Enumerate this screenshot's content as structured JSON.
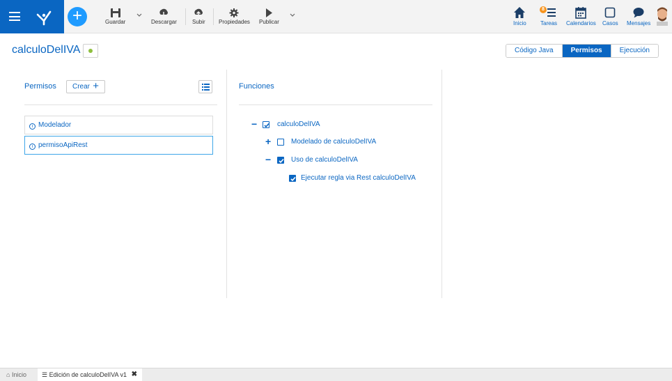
{
  "toolbar": {
    "save_label": "Guardar",
    "download_label": "Descargar",
    "upload_label": "Subir",
    "properties_label": "Propiedades",
    "publish_label": "Publicar"
  },
  "nav": {
    "home_label": "Inicio",
    "tasks_label": "Tareas",
    "tasks_badge": "8",
    "calendars_label": "Calendarios",
    "cases_label": "Casos",
    "messages_label": "Mensajes"
  },
  "header": {
    "title": "calculoDelIVA",
    "tabs": [
      {
        "label": "Código Java",
        "active": false
      },
      {
        "label": "Permisos",
        "active": true
      },
      {
        "label": "Ejecución",
        "active": false
      }
    ]
  },
  "permissions": {
    "title": "Permisos",
    "create_label": "Crear",
    "items": [
      {
        "label": "Modelador",
        "selected": false
      },
      {
        "label": "permisoApiRest",
        "selected": true
      }
    ]
  },
  "functions": {
    "title": "Funciones",
    "tree": [
      {
        "label": "calculoDelIVA",
        "toggle": "−",
        "checked": true,
        "level": 0
      },
      {
        "label": "Modelado de calculoDelIVA",
        "toggle": "+",
        "checked": false,
        "level": 1
      },
      {
        "label": "Uso de calculoDelIVA",
        "toggle": "−",
        "checked": true,
        "level": 1
      },
      {
        "label": "Ejecutar regla via Rest calculoDelIVA",
        "toggle": "",
        "checked": true,
        "level": 2
      }
    ]
  },
  "bottombar": {
    "home_label": "Inicio",
    "open_tab_label": "Edición de calculoDelIVA v1"
  },
  "colors": {
    "brand": "#0a66c2",
    "accent": "#1f9bff",
    "status_dot": "#8fbf3f",
    "badge": "#f7941d"
  }
}
